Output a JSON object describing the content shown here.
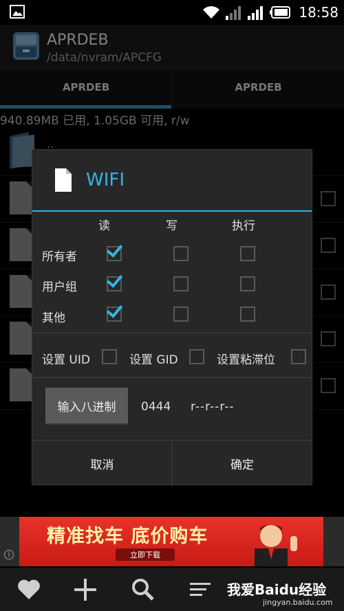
{
  "status_bar": {
    "time": "18:58"
  },
  "app": {
    "title": "APRDEB",
    "path": "/data/nvram/APCFG"
  },
  "tabs": [
    {
      "label": "APRDEB"
    },
    {
      "label": "APRDEB"
    }
  ],
  "storage_info": "940.89MB 已用, 1.05GB 可用, r/w",
  "file_list": {
    "parent_label": ".."
  },
  "dialog": {
    "title": "WIFI",
    "columns": {
      "read": "读",
      "write": "写",
      "execute": "执行"
    },
    "rows": [
      {
        "label": "所有者",
        "read": true,
        "write": false,
        "execute": false
      },
      {
        "label": "用户组",
        "read": true,
        "write": false,
        "execute": false
      },
      {
        "label": "其他",
        "read": true,
        "write": false,
        "execute": false
      }
    ],
    "special": {
      "uid": "设置 UID",
      "gid": "设置 GID",
      "sticky": "设置粘滞位"
    },
    "octal_button": "输入八进制",
    "octal_value": "0444",
    "perm_string": "r--r--r--",
    "cancel": "取消",
    "ok": "确定"
  },
  "ad": {
    "headline": "精准找车 底价购车",
    "cta": "立即下载",
    "info": "i"
  },
  "watermark": {
    "main": "我爱Baidu经验",
    "sub": "jingyan.baidu.com"
  },
  "colors": {
    "accent": "#32b5e5",
    "tab_indicator": "#3a8fb7",
    "background": "#000000"
  }
}
